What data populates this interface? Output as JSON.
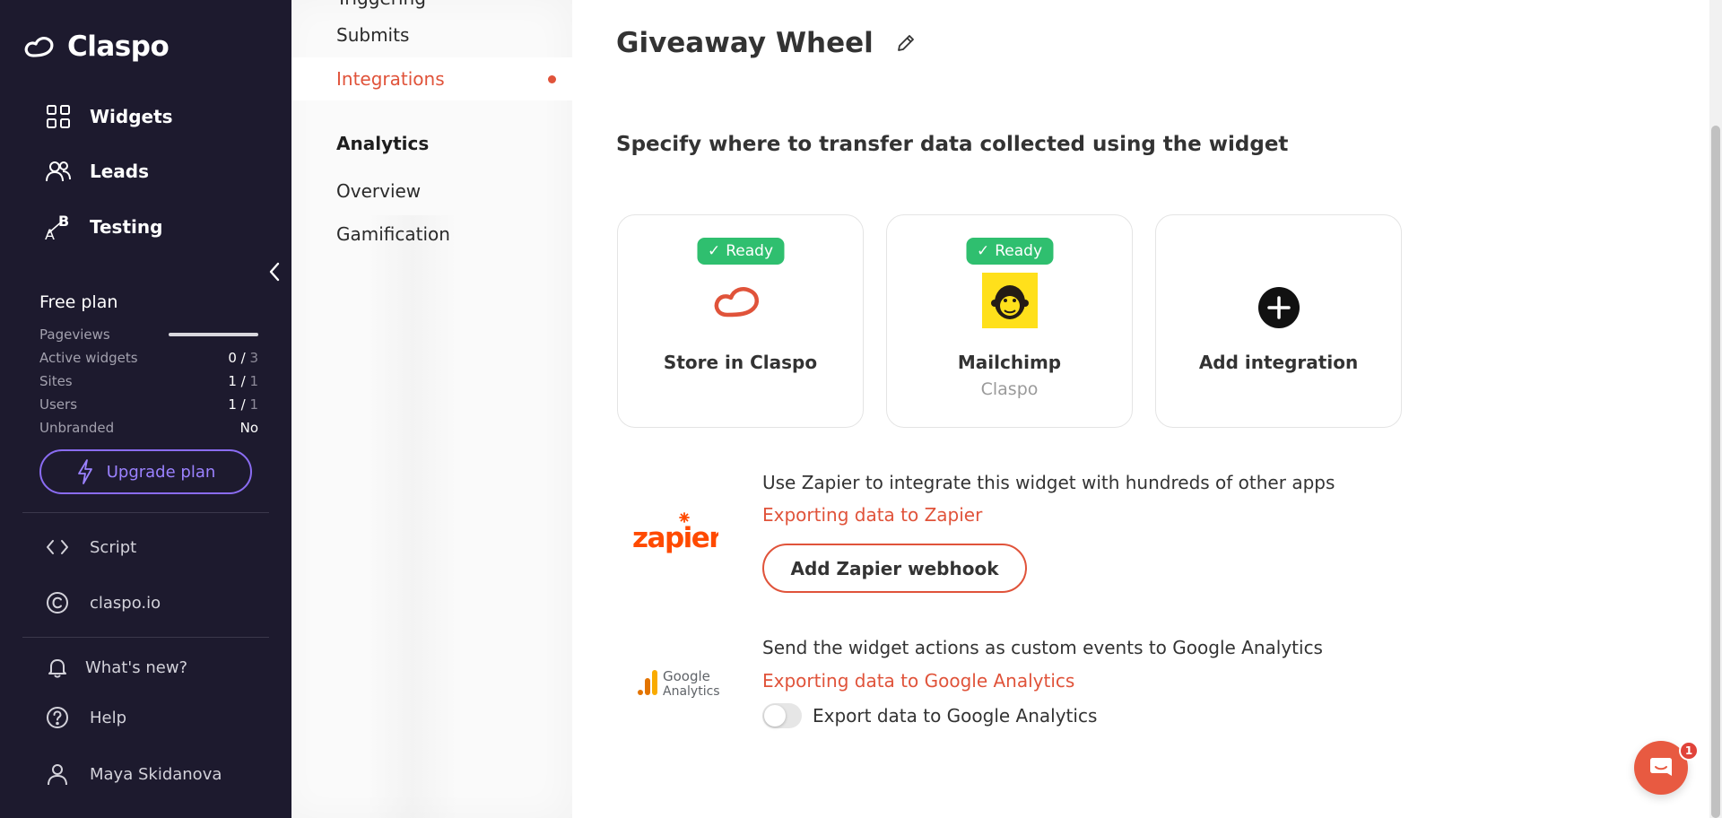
{
  "brand": {
    "name": "Claspo",
    "accent": "#e0533a",
    "sidebar_bg": "#1d1a2e"
  },
  "nav": {
    "widgets": {
      "label": "Widgets",
      "icon": "grid-icon"
    },
    "leads": {
      "label": "Leads",
      "icon": "users-icon"
    },
    "testing": {
      "label": "Testing",
      "icon": "ab-test-icon"
    }
  },
  "plan": {
    "title": "Free plan",
    "pageviews_label": "Pageviews",
    "pageviews_fill": 1.0,
    "active_widgets_label": "Active widgets",
    "active_widgets_used": "0",
    "active_widgets_total": "3",
    "sites_label": "Sites",
    "sites_used": "1",
    "sites_total": "1",
    "users_label": "Users",
    "users_used": "1",
    "users_total": "1",
    "unbranded_label": "Unbranded",
    "unbranded_value": "No",
    "upgrade_label": "Upgrade plan"
  },
  "side_links": {
    "script": "Script",
    "site": "claspo.io",
    "whats_new": "What's new?",
    "help": "Help",
    "user": "Maya Skidanova"
  },
  "subnav": {
    "cut_item": "Triggering",
    "submits": "Submits",
    "integrations": "Integrations",
    "analytics_heading": "Analytics",
    "overview": "Overview",
    "gamification": "Gamification"
  },
  "main": {
    "title": "Giveaway Wheel",
    "intro": "Specify where to transfer data collected using the widget",
    "cards": {
      "store": {
        "badge": "Ready",
        "name": "Store in Claspo"
      },
      "mailchimp": {
        "badge": "Ready",
        "name": "Mailchimp",
        "sub": "Claspo"
      },
      "add": {
        "name": "Add integration"
      }
    },
    "zapier": {
      "logo_text": "zapier",
      "text": "Use Zapier to integrate this widget with hundreds of other apps",
      "link": "Exporting data to Zapier",
      "button": "Add Zapier webhook"
    },
    "ga": {
      "logo_line1": "Google",
      "logo_line2": "Analytics",
      "text": "Send the widget actions as custom events to Google Analytics",
      "link": "Exporting data to Google Analytics",
      "toggle_label": "Export data to Google Analytics",
      "toggle_on": false
    }
  },
  "chat": {
    "unread": "1"
  }
}
